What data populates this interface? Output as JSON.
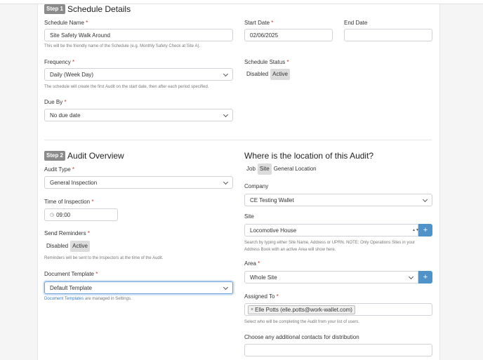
{
  "step1": {
    "badge": "Step 1",
    "title": "Schedule Details",
    "schedule_name": {
      "label": "Schedule Name",
      "value": "Site Safety Walk Around",
      "help": "This will be the friendly name of the Schedule (e.g. Monthly Safety Check at Site A)."
    },
    "start_date": {
      "label": "Start Date",
      "value": "02/06/2025"
    },
    "end_date": {
      "label": "End Date",
      "value": ""
    },
    "frequency": {
      "label": "Frequency",
      "value": "Daily (Week Day)",
      "help": "The schedule will create the first Audit on the start date, then after each period specified."
    },
    "schedule_status": {
      "label": "Schedule Status",
      "options": [
        "Disabled",
        "Active"
      ],
      "selected": "Active"
    },
    "due_by": {
      "label": "Due By",
      "value": "No due date"
    }
  },
  "step2": {
    "badge": "Step 2",
    "title": "Audit Overview",
    "audit_type": {
      "label": "Audit Type",
      "value": "General Inspection"
    },
    "time_of_inspection": {
      "label": "Time of Inspection",
      "value": "09:00"
    },
    "send_reminders": {
      "label": "Send Reminders",
      "options": [
        "Disabled",
        "Active"
      ],
      "selected": "Active",
      "help": "Reminders will be sent to the Inspectors at the time of the Audit."
    },
    "document_template": {
      "label": "Document Template",
      "value": "Default Template",
      "help_link": "Document Templates",
      "help_rest": " are managed in Settings."
    }
  },
  "location": {
    "title": "Where is the location of this Audit?",
    "options": [
      "Job",
      "Site",
      "General Location"
    ],
    "selected": "Site",
    "company": {
      "label": "Company",
      "value": "CE Testing Wallet"
    },
    "site": {
      "label": "Site",
      "value": "Locomotive House",
      "help_line1": "Search by typing either Site Name, Address or UPRN. NOTE: Only Operations Sites in your",
      "help_line2": "Address Book with an active Area will show here."
    },
    "area": {
      "label": "Area",
      "value": "Whole Site"
    },
    "assigned_to": {
      "label": "Assigned To",
      "tag": "Elle Potts (elle.potts@work-wallet.com)",
      "help": "Select who will be completing the Audit from your list of users."
    },
    "contacts": {
      "label": "Choose any additional contacts for distribution",
      "value": ""
    }
  },
  "common": {
    "required_mark": "*",
    "plus": "+",
    "remove": "×",
    "clock": "◷"
  }
}
